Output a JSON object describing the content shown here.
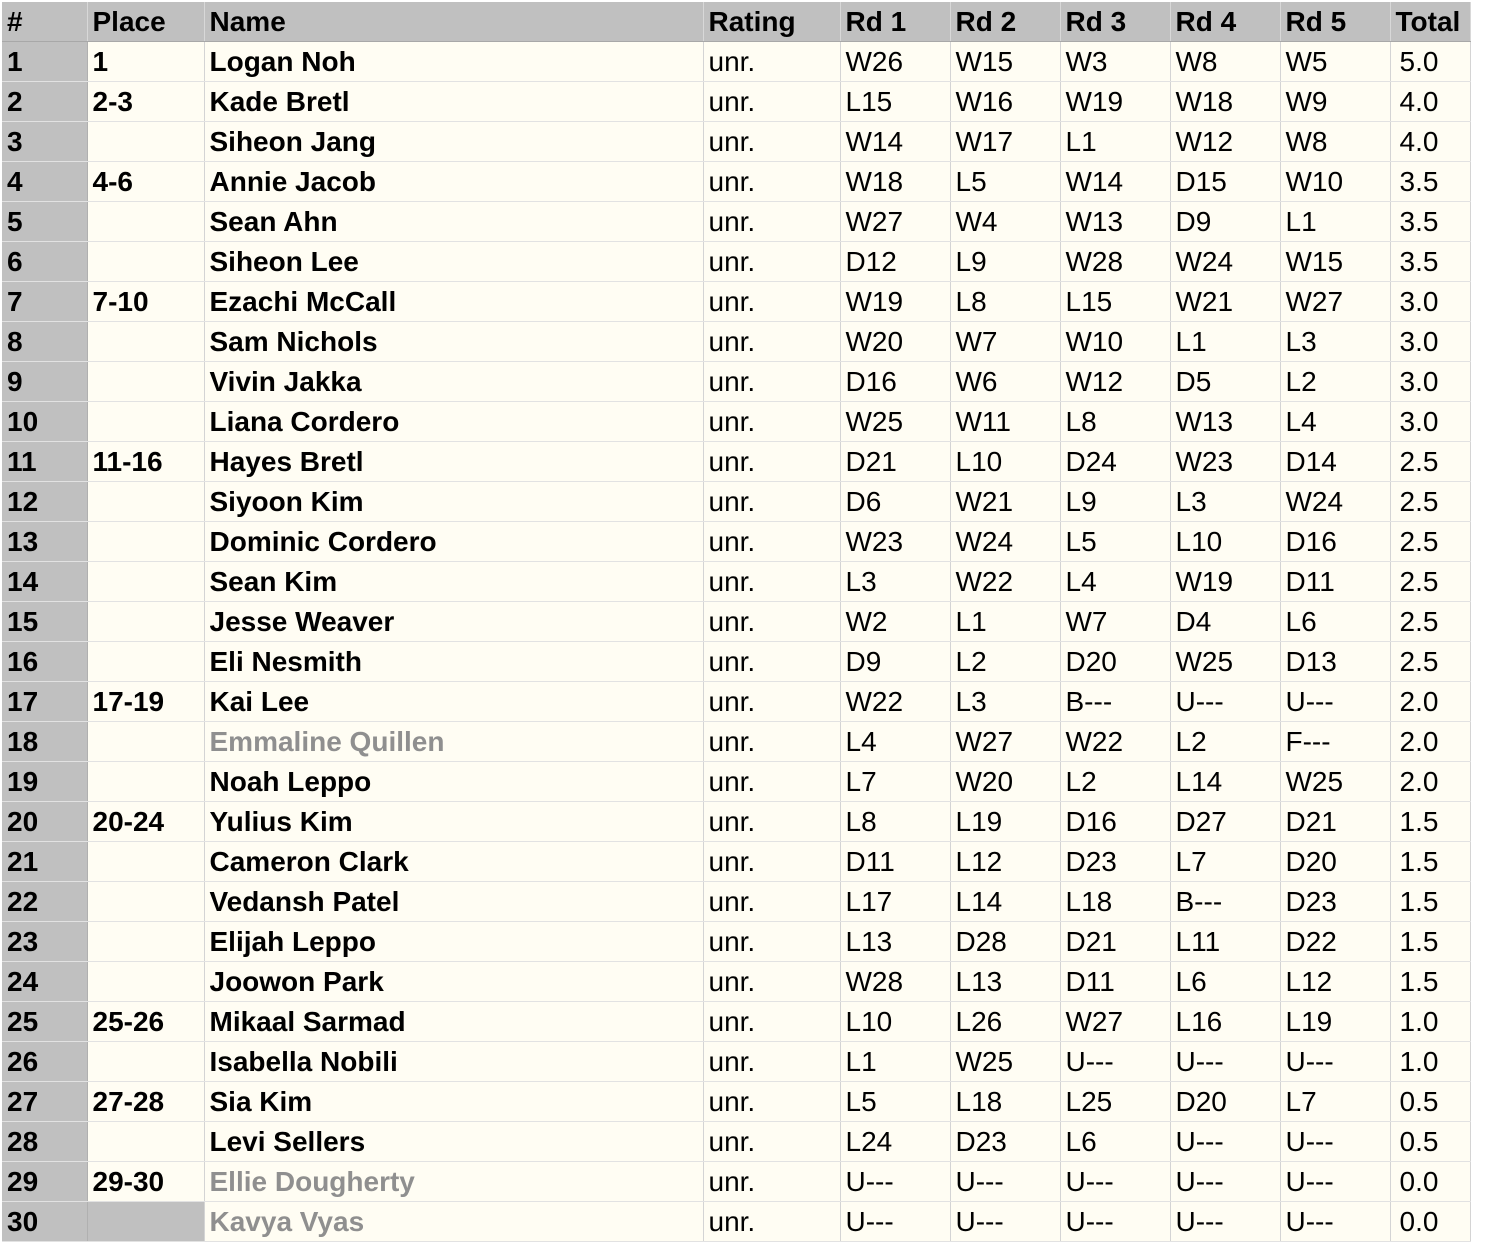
{
  "table": {
    "headers": [
      "#",
      "Place",
      "Name",
      "Rating",
      "Rd 1",
      "Rd 2",
      "Rd 3",
      "Rd 4",
      "Rd 5",
      "Total"
    ],
    "rows": [
      {
        "num": "1",
        "place": "1",
        "name": "Logan Noh",
        "rating": "unr.",
        "rounds": [
          "W26",
          "W15",
          "W3",
          "W8",
          "W5"
        ],
        "total": "5.0",
        "withdrawn": false
      },
      {
        "num": "2",
        "place": "2-3",
        "name": "Kade Bretl",
        "rating": "unr.",
        "rounds": [
          "L15",
          "W16",
          "W19",
          "W18",
          "W9"
        ],
        "total": "4.0",
        "withdrawn": false
      },
      {
        "num": "3",
        "place": "",
        "name": "Siheon Jang",
        "rating": "unr.",
        "rounds": [
          "W14",
          "W17",
          "L1",
          "W12",
          "W8"
        ],
        "total": "4.0",
        "withdrawn": false
      },
      {
        "num": "4",
        "place": "4-6",
        "name": "Annie Jacob",
        "rating": "unr.",
        "rounds": [
          "W18",
          "L5",
          "W14",
          "D15",
          "W10"
        ],
        "total": "3.5",
        "withdrawn": false
      },
      {
        "num": "5",
        "place": "",
        "name": "Sean Ahn",
        "rating": "unr.",
        "rounds": [
          "W27",
          "W4",
          "W13",
          "D9",
          "L1"
        ],
        "total": "3.5",
        "withdrawn": false
      },
      {
        "num": "6",
        "place": "",
        "name": "Siheon Lee",
        "rating": "unr.",
        "rounds": [
          "D12",
          "L9",
          "W28",
          "W24",
          "W15"
        ],
        "total": "3.5",
        "withdrawn": false
      },
      {
        "num": "7",
        "place": "7-10",
        "name": "Ezachi McCall",
        "rating": "unr.",
        "rounds": [
          "W19",
          "L8",
          "L15",
          "W21",
          "W27"
        ],
        "total": "3.0",
        "withdrawn": false
      },
      {
        "num": "8",
        "place": "",
        "name": "Sam Nichols",
        "rating": "unr.",
        "rounds": [
          "W20",
          "W7",
          "W10",
          "L1",
          "L3"
        ],
        "total": "3.0",
        "withdrawn": false
      },
      {
        "num": "9",
        "place": "",
        "name": "Vivin Jakka",
        "rating": "unr.",
        "rounds": [
          "D16",
          "W6",
          "W12",
          "D5",
          "L2"
        ],
        "total": "3.0",
        "withdrawn": false
      },
      {
        "num": "10",
        "place": "",
        "name": "Liana Cordero",
        "rating": "unr.",
        "rounds": [
          "W25",
          "W11",
          "L8",
          "W13",
          "L4"
        ],
        "total": "3.0",
        "withdrawn": false
      },
      {
        "num": "11",
        "place": "11-16",
        "name": "Hayes Bretl",
        "rating": "unr.",
        "rounds": [
          "D21",
          "L10",
          "D24",
          "W23",
          "D14"
        ],
        "total": "2.5",
        "withdrawn": false
      },
      {
        "num": "12",
        "place": "",
        "name": "Siyoon Kim",
        "rating": "unr.",
        "rounds": [
          "D6",
          "W21",
          "L9",
          "L3",
          "W24"
        ],
        "total": "2.5",
        "withdrawn": false
      },
      {
        "num": "13",
        "place": "",
        "name": "Dominic Cordero",
        "rating": "unr.",
        "rounds": [
          "W23",
          "W24",
          "L5",
          "L10",
          "D16"
        ],
        "total": "2.5",
        "withdrawn": false
      },
      {
        "num": "14",
        "place": "",
        "name": "Sean Kim",
        "rating": "unr.",
        "rounds": [
          "L3",
          "W22",
          "L4",
          "W19",
          "D11"
        ],
        "total": "2.5",
        "withdrawn": false
      },
      {
        "num": "15",
        "place": "",
        "name": "Jesse Weaver",
        "rating": "unr.",
        "rounds": [
          "W2",
          "L1",
          "W7",
          "D4",
          "L6"
        ],
        "total": "2.5",
        "withdrawn": false
      },
      {
        "num": "16",
        "place": "",
        "name": "Eli Nesmith",
        "rating": "unr.",
        "rounds": [
          "D9",
          "L2",
          "D20",
          "W25",
          "D13"
        ],
        "total": "2.5",
        "withdrawn": false
      },
      {
        "num": "17",
        "place": "17-19",
        "name": "Kai Lee",
        "rating": "unr.",
        "rounds": [
          "W22",
          "L3",
          "B---",
          "U---",
          "U---"
        ],
        "total": "2.0",
        "withdrawn": false
      },
      {
        "num": "18",
        "place": "",
        "name": "Emmaline Quillen",
        "rating": "unr.",
        "rounds": [
          "L4",
          "W27",
          "W22",
          "L2",
          "F---"
        ],
        "total": "2.0",
        "withdrawn": true
      },
      {
        "num": "19",
        "place": "",
        "name": "Noah Leppo",
        "rating": "unr.",
        "rounds": [
          "L7",
          "W20",
          "L2",
          "L14",
          "W25"
        ],
        "total": "2.0",
        "withdrawn": false
      },
      {
        "num": "20",
        "place": "20-24",
        "name": "Yulius Kim",
        "rating": "unr.",
        "rounds": [
          "L8",
          "L19",
          "D16",
          "D27",
          "D21"
        ],
        "total": "1.5",
        "withdrawn": false
      },
      {
        "num": "21",
        "place": "",
        "name": "Cameron Clark",
        "rating": "unr.",
        "rounds": [
          "D11",
          "L12",
          "D23",
          "L7",
          "D20"
        ],
        "total": "1.5",
        "withdrawn": false
      },
      {
        "num": "22",
        "place": "",
        "name": "Vedansh Patel",
        "rating": "unr.",
        "rounds": [
          "L17",
          "L14",
          "L18",
          "B---",
          "D23"
        ],
        "total": "1.5",
        "withdrawn": false
      },
      {
        "num": "23",
        "place": "",
        "name": "Elijah Leppo",
        "rating": "unr.",
        "rounds": [
          "L13",
          "D28",
          "D21",
          "L11",
          "D22"
        ],
        "total": "1.5",
        "withdrawn": false
      },
      {
        "num": "24",
        "place": "",
        "name": "Joowon Park",
        "rating": "unr.",
        "rounds": [
          "W28",
          "L13",
          "D11",
          "L6",
          "L12"
        ],
        "total": "1.5",
        "withdrawn": false
      },
      {
        "num": "25",
        "place": "25-26",
        "name": "Mikaal Sarmad",
        "rating": "unr.",
        "rounds": [
          "L10",
          "L26",
          "W27",
          "L16",
          "L19"
        ],
        "total": "1.0",
        "withdrawn": false
      },
      {
        "num": "26",
        "place": "",
        "name": "Isabella Nobili",
        "rating": "unr.",
        "rounds": [
          "L1",
          "W25",
          "U---",
          "U---",
          "U---"
        ],
        "total": "1.0",
        "withdrawn": false
      },
      {
        "num": "27",
        "place": "27-28",
        "name": "Sia Kim",
        "rating": "unr.",
        "rounds": [
          "L5",
          "L18",
          "L25",
          "D20",
          "L7"
        ],
        "total": "0.5",
        "withdrawn": false
      },
      {
        "num": "28",
        "place": "",
        "name": "Levi Sellers",
        "rating": "unr.",
        "rounds": [
          "L24",
          "D23",
          "L6",
          "U---",
          "U---"
        ],
        "total": "0.5",
        "withdrawn": false
      },
      {
        "num": "29",
        "place": "29-30",
        "name": "Ellie Dougherty",
        "rating": "unr.",
        "rounds": [
          "U---",
          "U---",
          "U---",
          "U---",
          "U---"
        ],
        "total": "0.0",
        "withdrawn": true
      },
      {
        "num": "30",
        "place": "",
        "name": "Kavya Vyas",
        "rating": "unr.",
        "rounds": [
          "U---",
          "U---",
          "U---",
          "U---",
          "U---"
        ],
        "total": "0.0",
        "withdrawn": true
      }
    ]
  },
  "colors": {
    "header_bg": "#c0c0c0",
    "cell_bg": "#fffdf3",
    "withdrawn_text": "#8f8f8f"
  }
}
